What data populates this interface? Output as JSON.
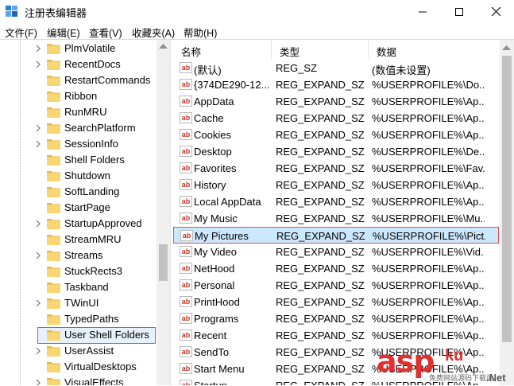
{
  "window": {
    "title": "注册表编辑器",
    "min_label": "minimize",
    "max_label": "maximize",
    "close_label": "close"
  },
  "menu": [
    "文件(F)",
    "编辑(E)",
    "查看(V)",
    "收藏夹(A)",
    "帮助(H)"
  ],
  "tree": {
    "items": [
      {
        "label": "PlmVolatile",
        "expandable": true
      },
      {
        "label": "RecentDocs",
        "expandable": true
      },
      {
        "label": "RestartCommands",
        "expandable": false
      },
      {
        "label": "Ribbon",
        "expandable": false
      },
      {
        "label": "RunMRU",
        "expandable": false
      },
      {
        "label": "SearchPlatform",
        "expandable": true
      },
      {
        "label": "SessionInfo",
        "expandable": true
      },
      {
        "label": "Shell Folders",
        "expandable": false
      },
      {
        "label": "Shutdown",
        "expandable": false
      },
      {
        "label": "SoftLanding",
        "expandable": false
      },
      {
        "label": "StartPage",
        "expandable": false
      },
      {
        "label": "StartupApproved",
        "expandable": true
      },
      {
        "label": "StreamMRU",
        "expandable": false
      },
      {
        "label": "Streams",
        "expandable": true
      },
      {
        "label": "StuckRects3",
        "expandable": false
      },
      {
        "label": "Taskband",
        "expandable": false
      },
      {
        "label": "TWinUI",
        "expandable": true
      },
      {
        "label": "TypedPaths",
        "expandable": false
      },
      {
        "label": "User Shell Folders",
        "expandable": false,
        "selected": true
      },
      {
        "label": "UserAssist",
        "expandable": true
      },
      {
        "label": "VirtualDesktops",
        "expandable": false
      },
      {
        "label": "VisualEffects",
        "expandable": true
      }
    ]
  },
  "list": {
    "columns": [
      "名称",
      "类型",
      "数据"
    ],
    "rows": [
      {
        "name": "(默认)",
        "type": "REG_SZ",
        "data": "(数值未设置)"
      },
      {
        "name": "{374DE290-12...",
        "type": "REG_EXPAND_SZ",
        "data": "%USERPROFILE%\\Do..."
      },
      {
        "name": "AppData",
        "type": "REG_EXPAND_SZ",
        "data": "%USERPROFILE%\\Ap..."
      },
      {
        "name": "Cache",
        "type": "REG_EXPAND_SZ",
        "data": "%USERPROFILE%\\Ap..."
      },
      {
        "name": "Cookies",
        "type": "REG_EXPAND_SZ",
        "data": "%USERPROFILE%\\Ap..."
      },
      {
        "name": "Desktop",
        "type": "REG_EXPAND_SZ",
        "data": "%USERPROFILE%\\De..."
      },
      {
        "name": "Favorites",
        "type": "REG_EXPAND_SZ",
        "data": "%USERPROFILE%\\Fav..."
      },
      {
        "name": "History",
        "type": "REG_EXPAND_SZ",
        "data": "%USERPROFILE%\\Ap..."
      },
      {
        "name": "Local AppData",
        "type": "REG_EXPAND_SZ",
        "data": "%USERPROFILE%\\Ap..."
      },
      {
        "name": "My Music",
        "type": "REG_EXPAND_SZ",
        "data": "%USERPROFILE%\\Mu..."
      },
      {
        "name": "My Pictures",
        "type": "REG_EXPAND_SZ",
        "data": "%USERPROFILE%\\Pict...",
        "selected": true
      },
      {
        "name": "My Video",
        "type": "REG_EXPAND_SZ",
        "data": "%USERPROFILE%\\Vid..."
      },
      {
        "name": "NetHood",
        "type": "REG_EXPAND_SZ",
        "data": "%USERPROFILE%\\Ap..."
      },
      {
        "name": "Personal",
        "type": "REG_EXPAND_SZ",
        "data": "%USERPROFILE%\\Ap..."
      },
      {
        "name": "PrintHood",
        "type": "REG_EXPAND_SZ",
        "data": "%USERPROFILE%\\Ap..."
      },
      {
        "name": "Programs",
        "type": "REG_EXPAND_SZ",
        "data": "%USERPROFILE%\\Ap..."
      },
      {
        "name": "Recent",
        "type": "REG_EXPAND_SZ",
        "data": "%USERPROFILE%\\Ap..."
      },
      {
        "name": "SendTo",
        "type": "REG_EXPAND_SZ",
        "data": "%USERPROFILE%\\Ap..."
      },
      {
        "name": "Start Menu",
        "type": "REG_EXPAND_SZ",
        "data": "%USERPROFILE%\\Ap..."
      },
      {
        "name": "Startup",
        "type": "REG_EXPAND_SZ",
        "data": "%USERPROFILE%\\Ap..."
      }
    ],
    "value_icon_text": "ab"
  },
  "watermark": {
    "brand": "asp",
    "brand_cn": "ku",
    "tagline": "免费网站源码下载站",
    "suffix": ".Net"
  },
  "colors": {
    "selection_fill": "#cce8ff",
    "selection_border": "#e0524a",
    "folder_yellow": "#f7d774",
    "watermark_red": "#e03030"
  }
}
